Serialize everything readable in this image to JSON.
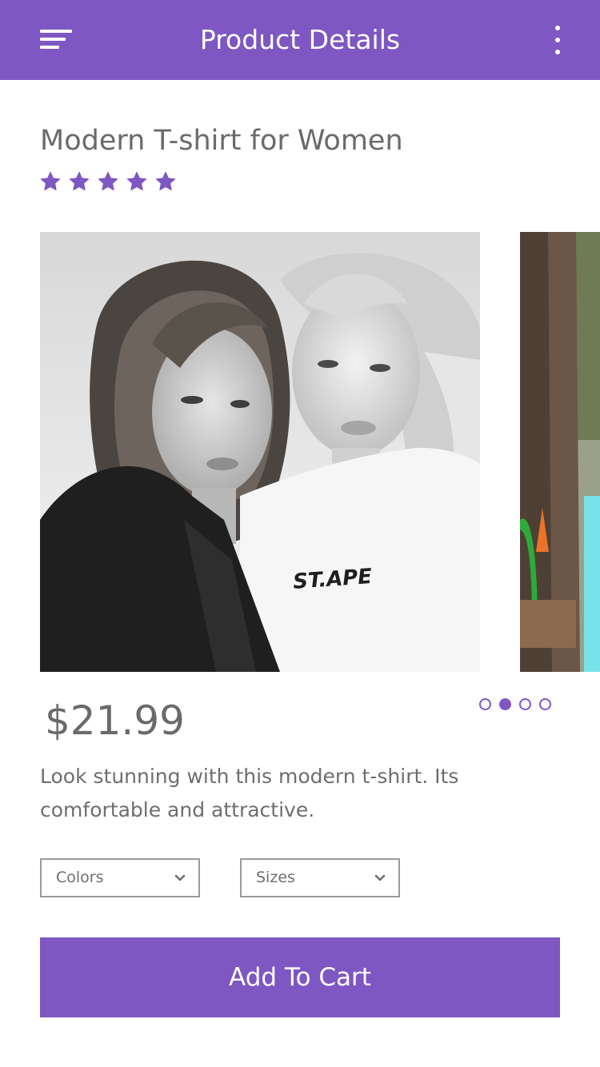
{
  "header": {
    "title": "Product Details",
    "menu_icon": "hamburger-menu-icon",
    "more_icon": "more-vertical-icon",
    "bg_color": "#7e57c2"
  },
  "product": {
    "title": "Modern T-shirt for Women",
    "rating": 5,
    "rating_max": 5,
    "star_color": "#7e57c2",
    "image_print_text": "ST.APE",
    "price": "$21.99",
    "description": "Look stunning with this modern t-shirt. Its comfortable and attractive."
  },
  "carousel": {
    "slide_count": 4,
    "active_index": 1
  },
  "options": {
    "colors_label": "Colors",
    "sizes_label": "Sizes"
  },
  "cta": {
    "add_to_cart_label": "Add To Cart"
  }
}
